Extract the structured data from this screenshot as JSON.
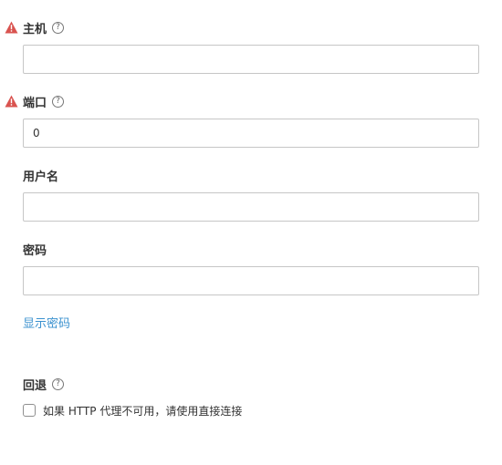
{
  "form": {
    "host": {
      "label": "主机",
      "help": "?",
      "value": "",
      "warning_icon": "warning-triangle-icon"
    },
    "port": {
      "label": "端口",
      "help": "?",
      "value": "0",
      "warning_icon": "warning-triangle-icon"
    },
    "username": {
      "label": "用户名",
      "value": ""
    },
    "password": {
      "label": "密码",
      "value": ""
    },
    "show_password": "显示密码",
    "fallback": {
      "label": "回退",
      "help": "?",
      "checkbox_label": "如果 HTTP 代理不可用，请使用直接连接",
      "checked": false
    }
  },
  "colors": {
    "warning": "#d9534f",
    "link": "#3a91cf",
    "input_border": "#c6c6c6"
  }
}
